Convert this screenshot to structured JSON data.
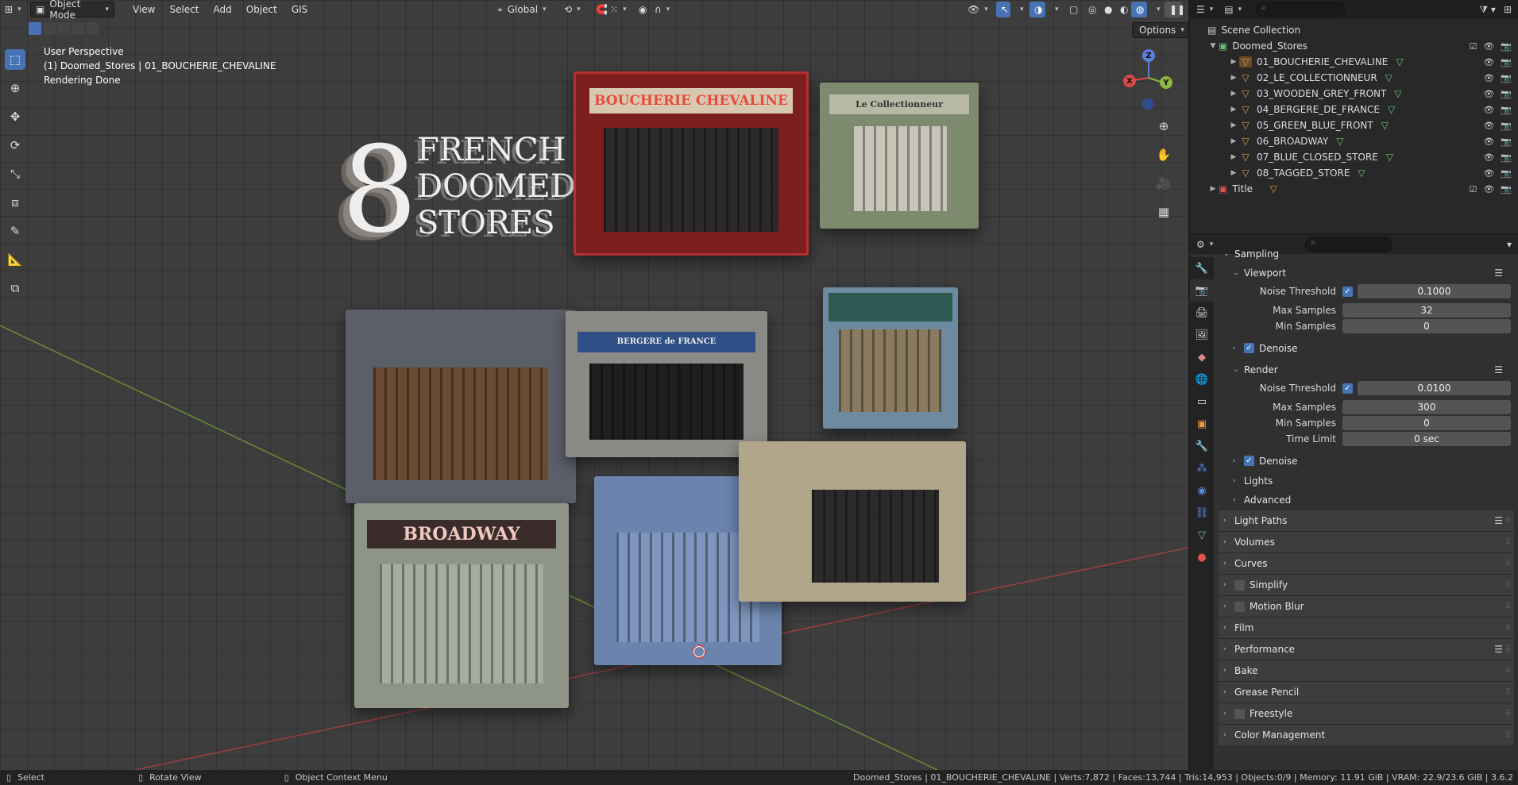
{
  "header": {
    "mode": "Object Mode",
    "menus": [
      "View",
      "Select",
      "Add",
      "Object",
      "GIS"
    ],
    "orientation": "Global",
    "options_label": "Options"
  },
  "overlay": {
    "perspective": "User Perspective",
    "context": "(1) Doomed_Stores | 01_BOUCHERIE_CHEVALINE",
    "status": "Rendering Done"
  },
  "scene_title": {
    "number": "8",
    "words": [
      "FRENCH",
      "DOOMED",
      "STORES"
    ]
  },
  "stores": {
    "s1": "BOUCHERIE CHEVALINE",
    "s2": "Le Collectionneur",
    "s4": "BERGERE de FRANCE",
    "s6": "BROADWAY"
  },
  "gizmo": {
    "z": "Z",
    "x": "X",
    "y": "Y"
  },
  "outliner": {
    "root": "Scene Collection",
    "collection": "Doomed_Stores",
    "objects": [
      "01_BOUCHERIE_CHEVALINE",
      "02_LE_COLLECTIONNEUR",
      "03_WOODEN_GREY_FRONT",
      "04_BERGERE_DE_FRANCE",
      "05_GREEN_BLUE_FRONT",
      "06_BROADWAY",
      "07_BLUE_CLOSED_STORE",
      "08_TAGGED_STORE"
    ],
    "title_collection": "Title"
  },
  "properties": {
    "sampling": "Sampling",
    "viewport": "Viewport",
    "noise_threshold_label": "Noise Threshold",
    "max_samples_label": "Max Samples",
    "min_samples_label": "Min Samples",
    "time_limit_label": "Time Limit",
    "denoise_label": "Denoise",
    "render": "Render",
    "viewport_noise_threshold": "0.1000",
    "viewport_max_samples": "32",
    "viewport_min_samples": "0",
    "render_noise_threshold": "0.0100",
    "render_max_samples": "300",
    "render_min_samples": "0",
    "render_time_limit": "0 sec",
    "lights": "Lights",
    "advanced": "Advanced",
    "sections": [
      "Light Paths",
      "Volumes",
      "Curves",
      "Simplify",
      "Motion Blur",
      "Film",
      "Performance",
      "Bake",
      "Grease Pencil",
      "Freestyle",
      "Color Management"
    ]
  },
  "statusbar": {
    "select": "Select",
    "rotate": "Rotate View",
    "context_menu": "Object Context Menu",
    "stats": "Doomed_Stores | 01_BOUCHERIE_CHEVALINE | Verts:7,872 | Faces:13,744 | Tris:14,953 | Objects:0/9 | Memory: 11.91 GiB | VRAM: 22.9/23.6 GiB | 3.6.2"
  }
}
